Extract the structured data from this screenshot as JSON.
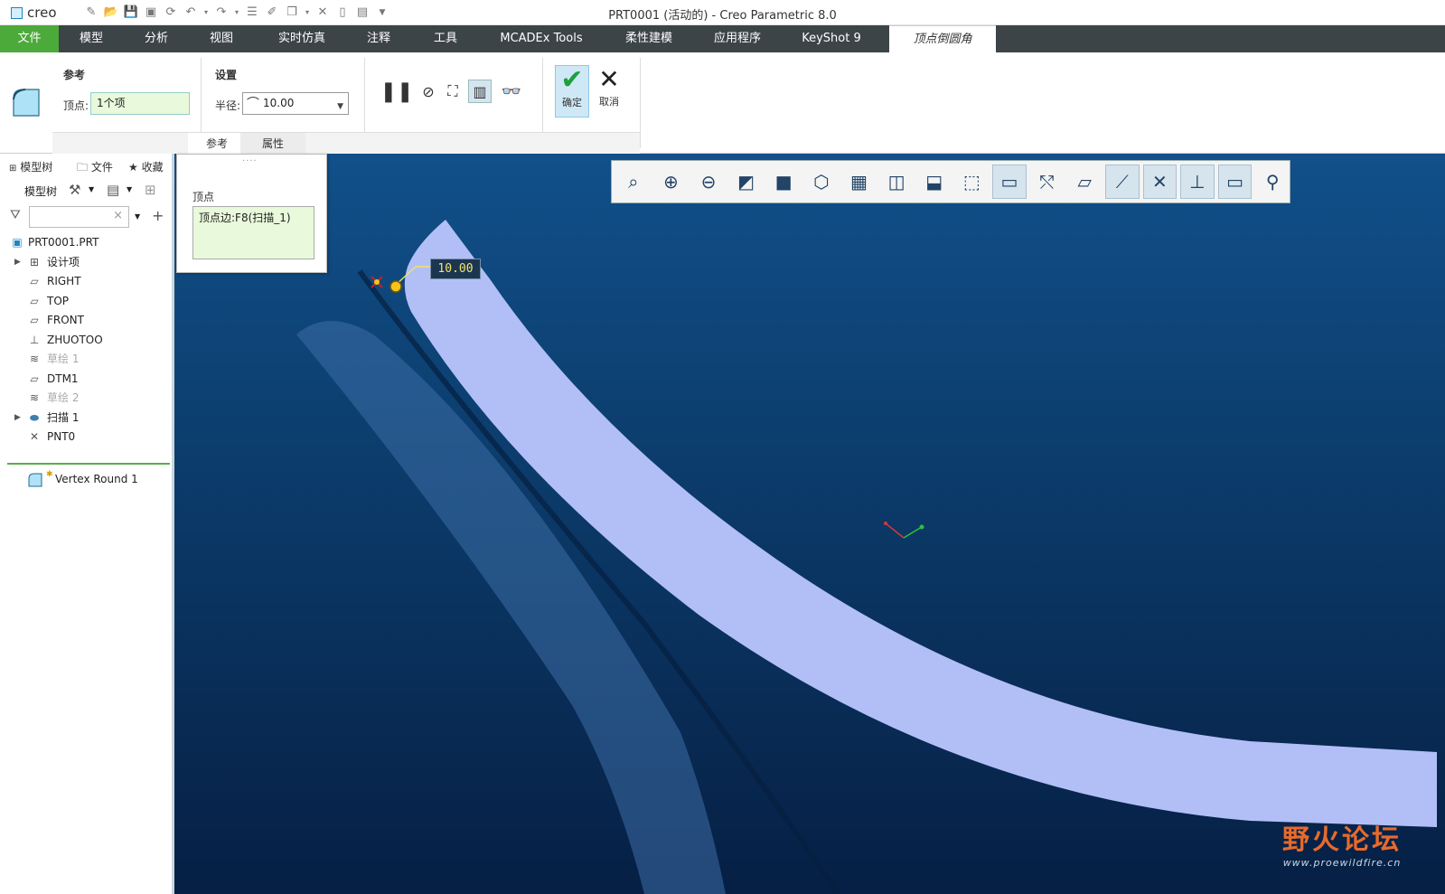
{
  "titlebar": {
    "brand": "creo",
    "window_title": "PRT0001 (活动的) - Creo Parametric 8.0"
  },
  "tabs": [
    {
      "label": "文件"
    },
    {
      "label": "模型"
    },
    {
      "label": "分析"
    },
    {
      "label": "视图"
    },
    {
      "label": "实时仿真"
    },
    {
      "label": "注释"
    },
    {
      "label": "工具"
    },
    {
      "label": "MCADEx Tools"
    },
    {
      "label": "柔性建模"
    },
    {
      "label": "应用程序"
    },
    {
      "label": "KeyShot 9"
    },
    {
      "label": "顶点倒圆角"
    }
  ],
  "ribbon": {
    "ref_group_label": "参考",
    "vertex_label": "顶点:",
    "vertex_value": "1个项",
    "settings_group_label": "设置",
    "radius_label": "半径:",
    "radius_value": "10.00",
    "ok_label": "确定",
    "cancel_label": "取消",
    "subtabs": [
      "参考",
      "属性"
    ]
  },
  "popup": {
    "title": "顶点",
    "value": "顶点边:F8(扫描_1)"
  },
  "left_panel": {
    "tabs": [
      "模型树",
      "文件",
      "收藏"
    ],
    "toolbar_label": "模型树",
    "tree": [
      {
        "label": "PRT0001.PRT",
        "icon": "part-icon",
        "dim": false,
        "expand": false
      },
      {
        "label": "设计项",
        "icon": "design-items-icon",
        "dim": false,
        "expand": true
      },
      {
        "label": "RIGHT",
        "icon": "plane-icon",
        "dim": false,
        "expand": false
      },
      {
        "label": "TOP",
        "icon": "plane-icon",
        "dim": false,
        "expand": false
      },
      {
        "label": "FRONT",
        "icon": "plane-icon",
        "dim": false,
        "expand": false
      },
      {
        "label": "ZHUOTOO",
        "icon": "csys-icon",
        "dim": false,
        "expand": false
      },
      {
        "label": "草绘 1",
        "icon": "sketch-icon",
        "dim": true,
        "expand": false
      },
      {
        "label": "DTM1",
        "icon": "plane-icon",
        "dim": false,
        "expand": false
      },
      {
        "label": "草绘 2",
        "icon": "sketch-icon",
        "dim": true,
        "expand": false
      },
      {
        "label": "扫描 1",
        "icon": "sweep-icon",
        "dim": false,
        "expand": true
      },
      {
        "label": "PNT0",
        "icon": "point-icon",
        "dim": false,
        "expand": false
      }
    ],
    "insert_item": "Vertex Round 1"
  },
  "viewport": {
    "dimension_value": "10.00"
  },
  "watermark": {
    "big": "野火论坛",
    "small": "www.proewildfire.cn"
  }
}
